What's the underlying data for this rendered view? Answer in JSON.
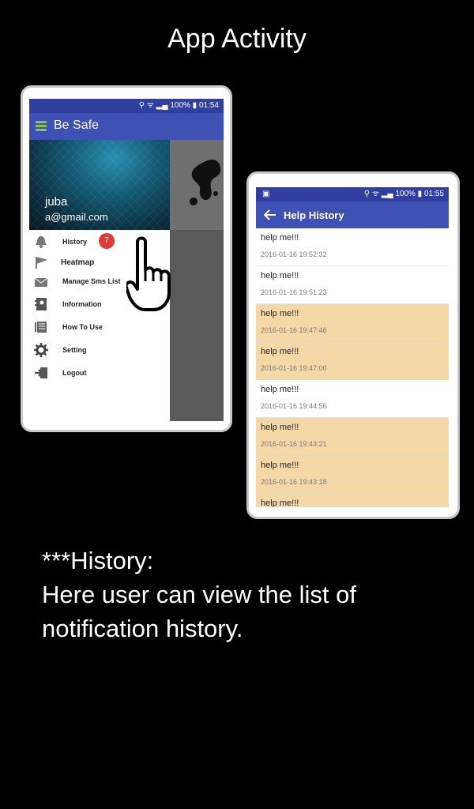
{
  "heading": "App Activity",
  "screen1": {
    "status": {
      "time": "01:54",
      "battery": "100%"
    },
    "app_title": "Be Safe",
    "user": {
      "name": "juba",
      "email": "a@gmail.com"
    },
    "menu": [
      {
        "label": "History",
        "icon": "bell-icon",
        "badge": "7"
      },
      {
        "label": "Heatmap",
        "icon": "flag-icon"
      },
      {
        "label": "Manage Sms List",
        "icon": "mail-icon"
      },
      {
        "label": "Information",
        "icon": "contacts-icon"
      },
      {
        "label": "How To Use",
        "icon": "list-icon"
      },
      {
        "label": "Setting",
        "icon": "gear-icon"
      },
      {
        "label": "Logout",
        "icon": "logout-icon"
      }
    ]
  },
  "screen2": {
    "status": {
      "time": "01:55",
      "battery": "100%"
    },
    "title": "Help History",
    "rows": [
      {
        "message": "help me!!!",
        "timestamp": "2016-01-16 19:52:32",
        "color": "#ffffff"
      },
      {
        "message": "help me!!!",
        "timestamp": "2016-01-16 19:51:23",
        "color": "#ffffff"
      },
      {
        "message": "help me!!!",
        "timestamp": "2016-01-16 19:47:46",
        "color": "#f6d7a6"
      },
      {
        "message": "help me!!!",
        "timestamp": "2016-01-16 19:47:00",
        "color": "#f6d7a6"
      },
      {
        "message": "help me!!!",
        "timestamp": "2016-01-16 19:44:56",
        "color": "#ffffff"
      },
      {
        "message": "help me!!!",
        "timestamp": "2016-01-16 19:43:21",
        "color": "#f6d7a6"
      },
      {
        "message": "help me!!!",
        "timestamp": "2016-01-16 19:43:18",
        "color": "#f6d7a6"
      },
      {
        "message": "help me!!!",
        "timestamp": "",
        "color": "#f6d7a6"
      }
    ]
  },
  "description": {
    "line1": "***History:",
    "line2": "Here user can view  the list of notification history."
  },
  "colors": {
    "primary": "#3f51b5",
    "primary_dark": "#303f9f",
    "highlight": "#f6d7a6",
    "badge": "#e53935",
    "accent": "#8bc34a"
  }
}
